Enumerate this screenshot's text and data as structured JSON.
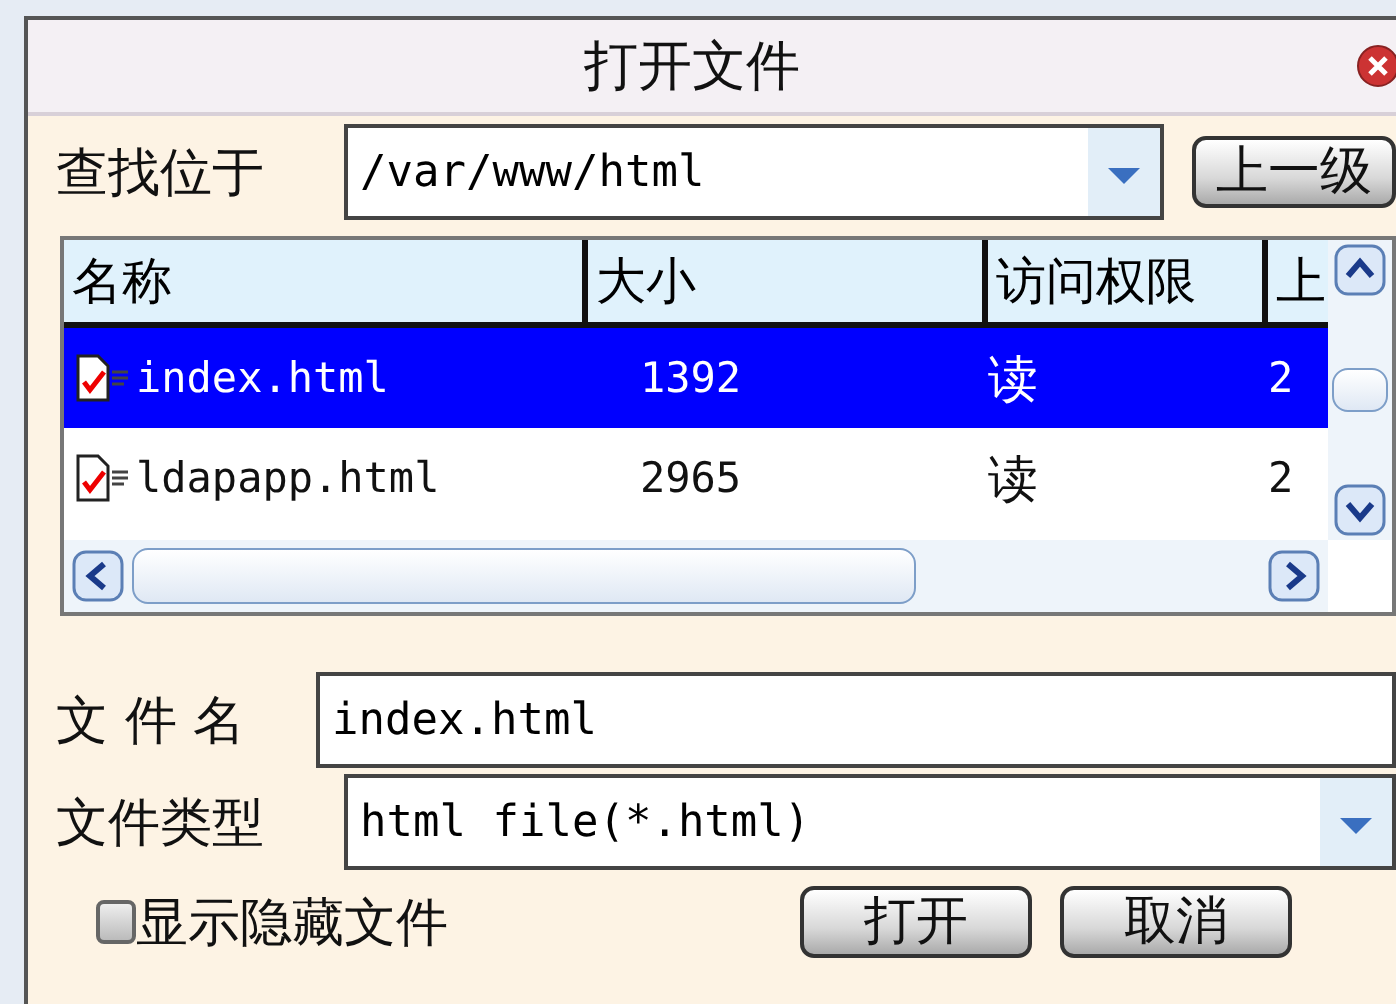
{
  "window": {
    "title": "打开文件"
  },
  "location": {
    "label": "查找位于",
    "value": "/var/www/html",
    "up_button": "上一级"
  },
  "table": {
    "columns": [
      "名称",
      "大小",
      "访问权限",
      "上"
    ],
    "rows": [
      {
        "name": "index.html",
        "size": "1392",
        "access": "读",
        "column_4": "2",
        "selected": true
      },
      {
        "name": "ldapapp.html",
        "size": "2965",
        "access": "读",
        "column_4": "2",
        "selected": false
      }
    ]
  },
  "filename": {
    "label": "文 件 名",
    "value": "index.html"
  },
  "filetype": {
    "label": "文件类型",
    "value": "html file(*.html)"
  },
  "show_hidden": {
    "label": "显示隐藏文件",
    "checked": false
  },
  "buttons": [
    "打开",
    "取消"
  ]
}
